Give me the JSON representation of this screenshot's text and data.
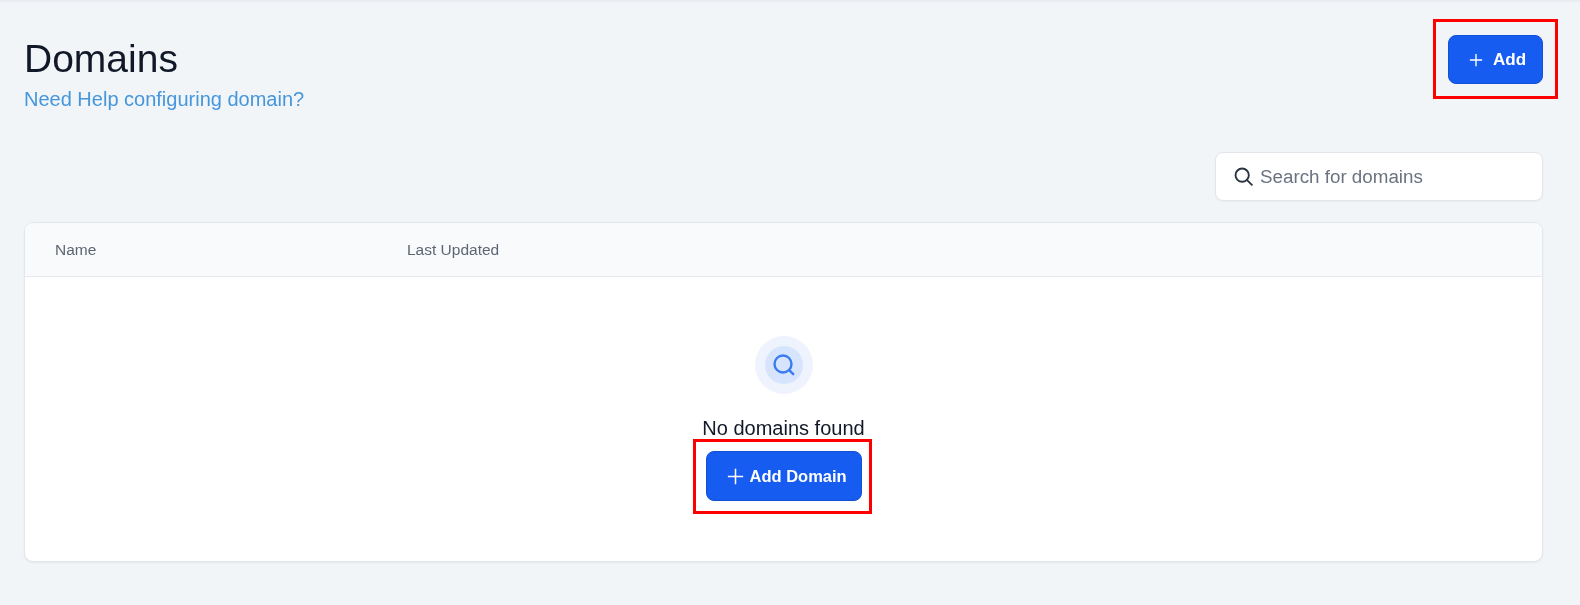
{
  "page": {
    "title": "Domains",
    "help_link": "Need Help configuring domain?"
  },
  "add_button": {
    "label": "Add",
    "highlighted": true
  },
  "search": {
    "placeholder": "Search for domains"
  },
  "table": {
    "columns": [
      "Name",
      "Last Updated"
    ],
    "empty_state": {
      "message": "No domains found",
      "button": {
        "label": "Add Domain",
        "highlighted": true
      }
    }
  }
}
